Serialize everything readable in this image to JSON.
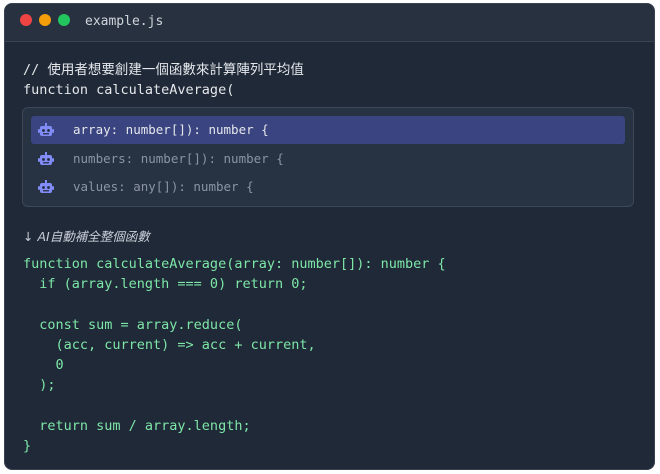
{
  "window": {
    "filename": "example.js",
    "traffic_lights": {
      "close_color": "#ef4444",
      "minimize_color": "#f59e0b",
      "maximize_color": "#22c55e"
    }
  },
  "editor": {
    "comment": "// 使用者想要創建一個函數來計算陣列平均值",
    "typed_line": "function calculateAverage("
  },
  "suggestions": {
    "icon": "robot-icon",
    "accent": "#6366f1",
    "items": [
      {
        "label": "array: number[]): number {",
        "selected": true
      },
      {
        "label": "numbers: number[]): number {",
        "selected": false
      },
      {
        "label": "values: any[]): number {",
        "selected": false
      }
    ]
  },
  "ai_note": {
    "arrow": "↓",
    "text": "AI自動補全整個函數"
  },
  "completion": {
    "color": "#7ee7a8",
    "lines": [
      "function calculateAverage(array: number[]): number {",
      "  if (array.length === 0) return 0;",
      "",
      "  const sum = array.reduce(",
      "    (acc, current) => acc + current,",
      "    0",
      "  );",
      "",
      "  return sum / array.length;",
      "}"
    ]
  }
}
